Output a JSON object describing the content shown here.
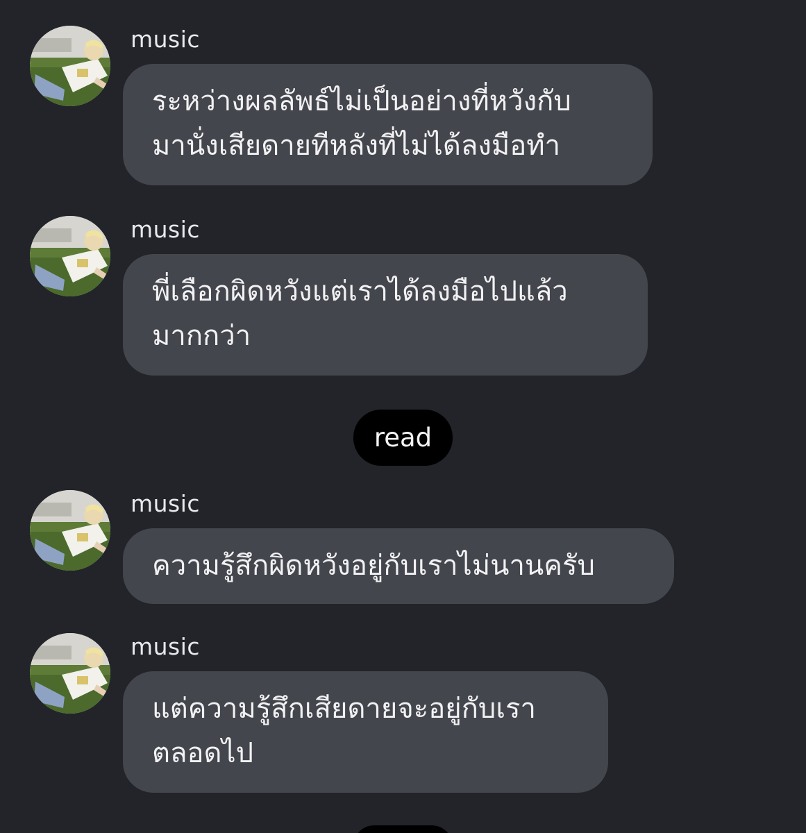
{
  "messages": [
    {
      "sender": "music",
      "lines": [
        "ระหว่างผลลัพธ์ไม่เป็นอย่างที่หวังกับ",
        "มานั่งเสียดายทีหลังที่ไม่ได้ลงมือทำ"
      ]
    },
    {
      "sender": "music",
      "lines": [
        "พี่เลือกผิดหวังแต่เราได้ลงมือไปแล้ว",
        "มากกว่า"
      ]
    },
    {
      "sender": "music",
      "lines": [
        "ความรู้สึกผิดหวังอยู่กับเราไม่นานครับ"
      ]
    },
    {
      "sender": "music",
      "lines": [
        "แต่ความรู้สึกเสียดายจะอยู่กับเรา",
        "ตลอดไป"
      ]
    }
  ],
  "read_label": "read",
  "icons": {
    "avatar": "profile-photo-avatar"
  },
  "colors": {
    "background": "#22242a",
    "bubble": "#44464d",
    "read_pill": "#000000",
    "text": "#f1f1f3"
  }
}
